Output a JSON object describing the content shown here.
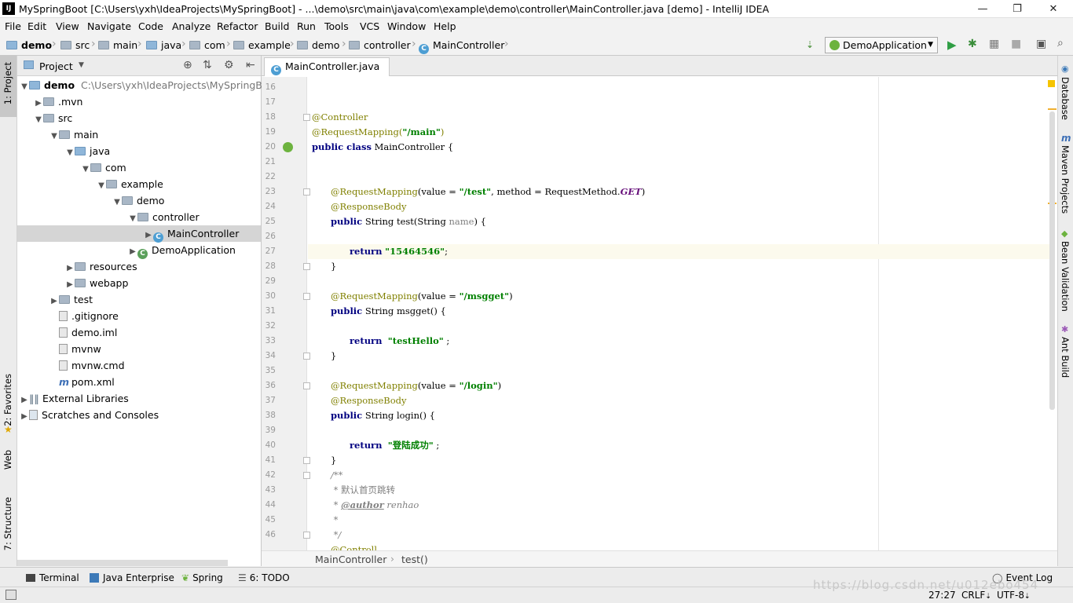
{
  "window": {
    "title": "MySpringBoot [C:\\Users\\yxh\\IdeaProjects\\MySpringBoot] - ...\\demo\\src\\main\\java\\com\\example\\demo\\controller\\MainController.java [demo] - IntelliJ IDEA",
    "app_icon": "IJ",
    "minimize": "—",
    "maximize": "❐",
    "close": "✕"
  },
  "menu": [
    "File",
    "Edit",
    "View",
    "Navigate",
    "Code",
    "Analyze",
    "Refactor",
    "Build",
    "Run",
    "Tools",
    "VCS",
    "Window",
    "Help"
  ],
  "breadcrumbs": [
    "demo",
    "src",
    "main",
    "java",
    "com",
    "example",
    "demo",
    "controller",
    "MainController"
  ],
  "run_config": "DemoApplication",
  "project_panel": {
    "title": "Project",
    "tree": [
      {
        "label": "demo",
        "extra": "C:\\Users\\yxh\\IdeaProjects\\MySpringBoot"
      },
      {
        "label": ".mvn"
      },
      {
        "label": "src"
      },
      {
        "label": "main"
      },
      {
        "label": "java"
      },
      {
        "label": "com"
      },
      {
        "label": "example"
      },
      {
        "label": "demo"
      },
      {
        "label": "controller"
      },
      {
        "label": "MainController"
      },
      {
        "label": "DemoApplication"
      },
      {
        "label": "resources"
      },
      {
        "label": "webapp"
      },
      {
        "label": "test"
      },
      {
        "label": ".gitignore"
      },
      {
        "label": "demo.iml"
      },
      {
        "label": "mvnw"
      },
      {
        "label": "mvnw.cmd"
      },
      {
        "label": "pom.xml"
      },
      {
        "label": "External Libraries"
      },
      {
        "label": "Scratches and Consoles"
      }
    ]
  },
  "left_tabs": [
    "1: Project",
    "2: Favorites",
    "Web",
    "7: Structure"
  ],
  "right_tabs": [
    "Database",
    "Maven Projects",
    "Bean Validation",
    "Ant Build"
  ],
  "editor": {
    "tab": "MainController.java",
    "line_numbers": [
      "16",
      "17",
      "18",
      "19",
      "20",
      "21",
      "22",
      "23",
      "24",
      "25",
      "26",
      "27",
      "28",
      "29",
      "30",
      "31",
      "32",
      "33",
      "34",
      "35",
      "36",
      "37",
      "38",
      "39",
      "40",
      "41",
      "42",
      "43",
      "44",
      "45",
      "46"
    ],
    "code": {
      "l18_ann": "@Controller",
      "l19_ann": "@RequestMapping(",
      "l19_str": "\"/main\"",
      "l19_end": ")",
      "l20_kw": "public class",
      "l20_rest": " MainController {",
      "l23_ann": "@RequestMapping",
      "l23_a": "(value = ",
      "l23_str": "\"/test\"",
      "l23_b": ", method = RequestMethod.",
      "l23_const": "GET",
      "l23_c": ")",
      "l24_ann": "@ResponseBody",
      "l25_kw": "public",
      "l25_a": " String test(String ",
      "l25_param": "name",
      "l25_b": ") {",
      "l27_kw": "return",
      "l27_str": "\"15464546\"",
      "l27_end": ";",
      "l28": "}",
      "l30_ann": "@RequestMapping",
      "l30_a": "(value = ",
      "l30_str": "\"/msgget\"",
      "l30_b": ")",
      "l31_kw": "public",
      "l31_a": " String msgget() {",
      "l33_kw": "return",
      "l33_str": "\"testHello\"",
      "l33_end": " ;",
      "l34": "}",
      "l36_ann": "@RequestMapping",
      "l36_a": "(value = ",
      "l36_str": "\"/login\"",
      "l36_b": ")",
      "l37_ann": "@ResponseBody",
      "l38_kw": "public",
      "l38_a": " String login() {",
      "l40_kw": "return",
      "l40_str": "\"登陆成功\"",
      "l40_end": " ;",
      "l41": "}",
      "l42": "/**",
      "l43": " * 默认首页跳转",
      "l44_a": " * ",
      "l44_tag": "@author",
      "l44_b": " renhao",
      "l45": " *",
      "l46": " */",
      "l47": "@Controll"
    },
    "breadcrumb": [
      "MainController",
      "test()"
    ]
  },
  "bottom_tools": [
    "Terminal",
    "Java Enterprise",
    "Spring",
    "6: TODO",
    "Event Log"
  ],
  "status": {
    "position": "27:27",
    "line_sep": "CRLF",
    "encoding": "UTF-8"
  },
  "watermark": "https://blog.csdn.net/u012ebo454"
}
